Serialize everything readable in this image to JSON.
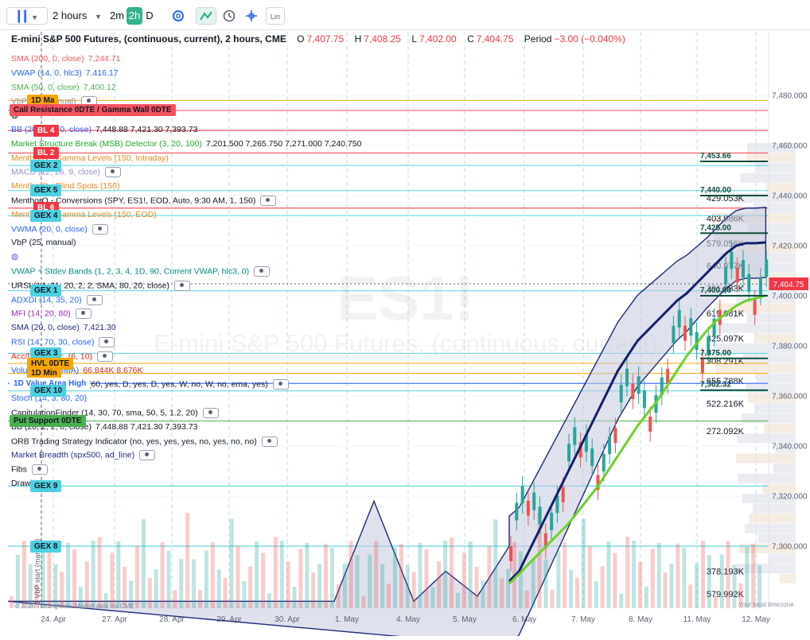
{
  "toolbar": {
    "interval_label": "2 hours",
    "btn_2m": "2m",
    "btn_2h": "2h",
    "btn_d": "D",
    "lin_label": "Lin"
  },
  "header": {
    "symbol_title": "E-mini S&P 500 Futures, (continuous, current), 2 hours, CME",
    "o_label": "O",
    "o_value": "7,407.75",
    "h_label": "H",
    "h_value": "7,408.25",
    "l_label": "L",
    "l_value": "7,402.00",
    "c_label": "C",
    "c_value": "7,404.75",
    "period_label": "Period",
    "period_value": "−3.00 (−0.040%)"
  },
  "watermark": {
    "symbol": "ES1!",
    "name": "E-mini S&P 500 Futures, (continuous, current)"
  },
  "legend": [
    {
      "name": "SMA (200, 0, close)",
      "values": "7,244.71",
      "color": "#f7525f",
      "vcolor": "#f7525f"
    },
    {
      "name": "VWAP (14, 0, hlc3)",
      "values": "7,416.17",
      "color": "#2962ff",
      "vcolor": "#2962ff"
    },
    {
      "name": "SMA (50, 0, close)",
      "values": "7,400.12",
      "color": "#4caf50",
      "vcolor": "#4caf50"
    },
    {
      "name": "VbP (25, manual)",
      "values": "",
      "color": "#8a8fa3",
      "vcolor": "#8a8fa3",
      "eye": true
    },
    {
      "name": "",
      "values": "",
      "color": "#131722",
      "vcolor": "#131722"
    },
    {
      "name": "BB (20, 2, 2, 0, close)",
      "values": "7,448.88  7,421.30  7,393.73",
      "color": "#2962ff",
      "vcolor": "#131722"
    },
    {
      "name": "Market Structure Break (MSB) Detector (3, 20, 100)",
      "values": "7,201.500  7,265.750  7,271.000  7,240.750",
      "color": "#22ab28",
      "vcolor": "#131722",
      "vlast": "#d6281c"
    },
    {
      "name": "MenthorQ - Gamma Levels (150, Intraday)",
      "values": "",
      "color": "#e8891e",
      "vcolor": "#e8891e"
    },
    {
      "name": "MACD (12, 26, 9, close)",
      "values": "",
      "color": "#9c8ad4",
      "vcolor": "#9c8ad4",
      "eye": true
    },
    {
      "name": "MenthorQ - Blind Spots (150)",
      "values": "",
      "color": "#e8891e",
      "vcolor": "#e8891e"
    },
    {
      "name": "MenthorQ - Conversions (SPY, ES1!, EOD, Auto, 9:30 AM, 1, 150)",
      "values": "",
      "color": "#131722",
      "vcolor": "#131722",
      "eye": true
    },
    {
      "name": "MenthorQ - Gamma Levels (150, EOD)",
      "values": "",
      "color": "#e8891e",
      "vcolor": "#e8891e"
    },
    {
      "name": "VWMA (20, 0, close)",
      "values": "",
      "color": "#2962ff",
      "vcolor": "#2962ff",
      "eye": true
    },
    {
      "name": "VbP (25, manual)",
      "values": "",
      "color": "#131722",
      "vcolor": "#131722"
    },
    {
      "name": "",
      "values": "",
      "color": "#7b4fd6",
      "vcolor": "#7b4fd6"
    },
    {
      "name": "VWAP + Stdev Bands (1, 2, 3, 4, 1D, 90, Current VWAP, hlc3, 0)",
      "values": "",
      "color": "#00897b",
      "vcolor": "#00897b",
      "eye": true
    },
    {
      "name": "URSI (14, 21, 20, 2, 2, SMA, 80, 20, close)",
      "values": "",
      "color": "#131722",
      "vcolor": "#131722",
      "eye": true
    },
    {
      "name": "ADXDI (14, 35, 20)",
      "values": "",
      "color": "#2962ff",
      "vcolor": "#2962ff",
      "eye": true
    },
    {
      "name": "MFI (14, 20, 80)",
      "values": "",
      "color": "#9c27b0",
      "vcolor": "#9c27b0",
      "eye": true
    },
    {
      "name": "SMA (20, 0, close)",
      "values": "7,421.30",
      "color": "#1e2a78",
      "vcolor": "#1e2a78"
    },
    {
      "name": "RSI (14, 70, 30, close)",
      "values": "",
      "color": "#2962ff",
      "vcolor": "#2962ff",
      "eye": true
    },
    {
      "name": "Acc/Distri Osc. (6, 10)",
      "values": "",
      "color": "#d6281c",
      "vcolor": "#d6281c",
      "eye": true
    },
    {
      "name": "Volume (20, SMA)",
      "values": "66.844K  8.676K",
      "color": "#2962ff",
      "vcolor": "#d6281c"
    },
    {
      "name": "Ripster EMA Clouds (60, yes, D, yes, D, yes, W, no, W, no, ema, yes)",
      "values": "",
      "color": "#131722",
      "vcolor": "#131722",
      "eye": true
    },
    {
      "name": "Stoch (14, 3, 80, 20)",
      "values": "",
      "color": "#2962ff",
      "vcolor": "#2962ff"
    },
    {
      "name": "CapitulationFinder (14, 30, 70, sma, 50, 5, 1.2, 20)",
      "values": "",
      "color": "#131722",
      "vcolor": "#131722",
      "eye": true
    },
    {
      "name": "BB (20, 2, 2, 0, close)",
      "values": "7,448.88  7,421.30  7,393.73",
      "color": "#131722",
      "vcolor": "#131722"
    },
    {
      "name": "ORB Trading Strategy Indicator (no, yes, yes, yes, no, yes, no, no)",
      "values": "",
      "color": "#131722",
      "vcolor": "#131722",
      "eye": true
    },
    {
      "name": "Market Breadth (spx500, ad_line)",
      "values": "",
      "color": "#1e2a78",
      "vcolor": "#1e2a78",
      "eye": true
    },
    {
      "name": "Fibs",
      "values": "",
      "color": "#131722",
      "vcolor": "#131722",
      "eye": true
    },
    {
      "name": "Drawings",
      "values": "",
      "color": "#131722",
      "vcolor": "#131722"
    }
  ],
  "tags": [
    {
      "text": "1D Ma",
      "bg": "#f7a600",
      "fg": "#131722",
      "price": 7478
    },
    {
      "text": "Call Resistance 0DTE / Gamma Wall 0DTE",
      "bg": "#f7525f",
      "fg": "#131722",
      "price": 7474
    },
    {
      "text": "BL 4",
      "bg": "#f23645",
      "fg": "#ffffff",
      "price": 7466
    },
    {
      "text": "BL 2",
      "bg": "#f23645",
      "fg": "#ffffff",
      "price": 7457
    },
    {
      "text": "GEX 2",
      "bg": "#4dd0e1",
      "fg": "#131722",
      "price": 7452
    },
    {
      "text": "GEX 5",
      "bg": "#4dd0e1",
      "fg": "#131722",
      "price": 7442
    },
    {
      "text": "BL 6",
      "bg": "#f23645",
      "fg": "#ffffff",
      "price": 7435
    },
    {
      "text": "GEX 4",
      "bg": "#4dd0e1",
      "fg": "#131722",
      "price": 7432
    },
    {
      "text": "GEX 1",
      "bg": "#4dd0e1",
      "fg": "#131722",
      "price": 7402
    },
    {
      "text": "GEX 3",
      "bg": "#4dd0e1",
      "fg": "#131722",
      "price": 7377
    },
    {
      "text": "HVL 0DTE",
      "bg": "#f7a600",
      "fg": "#131722",
      "price": 7373
    },
    {
      "text": "1D Min",
      "bg": "#f7a600",
      "fg": "#131722",
      "price": 7369
    },
    {
      "text": "1D Value Area High",
      "bg": "#ffffff",
      "fg": "#2962ff",
      "price": 7365
    },
    {
      "text": "GEX 10",
      "bg": "#4dd0e1",
      "fg": "#131722",
      "price": 7362
    },
    {
      "text": "Put Support 0DTE",
      "bg": "#4caf50",
      "fg": "#131722",
      "price": 7350
    },
    {
      "text": "GEX 9",
      "bg": "#4dd0e1",
      "fg": "#131722",
      "price": 7324
    },
    {
      "text": "GEX 8",
      "bg": "#4dd0e1",
      "fg": "#131722",
      "price": 7300
    }
  ],
  "vertical_label": "1 VbP start (manual)",
  "last_price_label": "7,404.75",
  "price_annotations": [
    {
      "text": "7,453.66",
      "price": 7453.66,
      "kind": "level"
    },
    {
      "text": "7,440.00",
      "price": 7440.0,
      "kind": "level"
    },
    {
      "text": "7,425.00",
      "price": 7425.0,
      "kind": "level"
    },
    {
      "text": "7,400.00",
      "price": 7400.0,
      "kind": "level"
    },
    {
      "text": "7,375.00",
      "price": 7375.0,
      "kind": "level"
    },
    {
      "text": "7,362.32",
      "price": 7362.32,
      "kind": "level"
    }
  ],
  "volume_profile_labels": [
    {
      "text": "429.053K",
      "price": 7439
    },
    {
      "text": "403.986K",
      "price": 7431
    },
    {
      "text": "579.056K",
      "price": 7421
    },
    {
      "text": "640.077K",
      "price": 7412
    },
    {
      "text": "391.083K",
      "price": 7403
    },
    {
      "text": "619.081K",
      "price": 7393
    },
    {
      "text": "425.097K",
      "price": 7383
    },
    {
      "text": "308.291K",
      "price": 7374
    },
    {
      "text": "655.788K",
      "price": 7366
    },
    {
      "text": "522.216K",
      "price": 7357
    },
    {
      "text": "272.092K",
      "price": 7346
    },
    {
      "text": "378.193K",
      "price": 7290
    },
    {
      "text": "579.992K",
      "price": 7281
    }
  ],
  "footer": {
    "copyright": "© 2026 TradingView, Market data via CME",
    "timezone": "Your local timezone"
  },
  "colors": {
    "up": "#26a69a",
    "down": "#ef5350",
    "sma20": "#131f6b",
    "sma50": "#6bd128",
    "band_fill": "#c4c9dd",
    "band_line": "#1e2a78",
    "vwap_thin": "#5c8ef2"
  },
  "chart_data": {
    "type": "candlestick",
    "title": "E-mini S&P 500 Futures, (continuous, current), 2 hours, CME",
    "symbol": "ES1!",
    "interval": "2 hours",
    "x_ticks": [
      "24. Apr",
      "27. Apr",
      "28. Apr",
      "29. Apr",
      "30. Apr",
      "1. May",
      "4. May",
      "5. May",
      "6. May",
      "7. May",
      "8. May",
      "11. May",
      "12. May"
    ],
    "y_ticks": [
      7300,
      7320,
      7340,
      7360,
      7380,
      7400,
      7420,
      7440,
      7460,
      7480
    ],
    "ylim": [
      7285,
      7500
    ],
    "last": 7404.75,
    "series": [
      {
        "name": "SMA (20, 0, close)",
        "values": [
          7286,
          7290,
          7298,
          7306,
          7314,
          7322,
          7330,
          7338,
          7346,
          7354,
          7362,
          7370,
          7376,
          7382,
          7386,
          7390,
          7394,
          7398,
          7401,
          7405,
          7409,
          7413,
          7417,
          7420,
          7421,
          7421,
          7421.3
        ]
      },
      {
        "name": "SMA (50, 0, close)",
        "values": [
          7285,
          7289,
          7293,
          7297,
          7301,
          7305,
          7309,
          7314,
          7319,
          7324,
          7330,
          7336,
          7342,
          7348,
          7353,
          7358,
          7364,
          7370,
          7376,
          7381,
          7386,
          7390,
          7393,
          7396,
          7398,
          7399,
          7400.12
        ]
      }
    ]
  }
}
